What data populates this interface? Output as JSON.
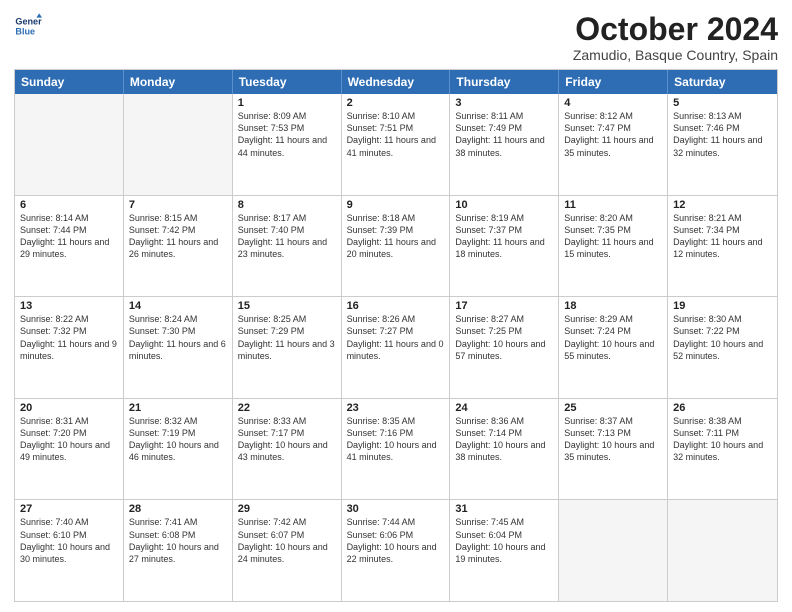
{
  "logo": {
    "line1": "General",
    "line2": "Blue"
  },
  "title": "October 2024",
  "location": "Zamudio, Basque Country, Spain",
  "days_of_week": [
    "Sunday",
    "Monday",
    "Tuesday",
    "Wednesday",
    "Thursday",
    "Friday",
    "Saturday"
  ],
  "weeks": [
    [
      {
        "day": "",
        "content": "",
        "empty": true
      },
      {
        "day": "",
        "content": "",
        "empty": true
      },
      {
        "day": "1",
        "content": "Sunrise: 8:09 AM\nSunset: 7:53 PM\nDaylight: 11 hours and 44 minutes."
      },
      {
        "day": "2",
        "content": "Sunrise: 8:10 AM\nSunset: 7:51 PM\nDaylight: 11 hours and 41 minutes."
      },
      {
        "day": "3",
        "content": "Sunrise: 8:11 AM\nSunset: 7:49 PM\nDaylight: 11 hours and 38 minutes."
      },
      {
        "day": "4",
        "content": "Sunrise: 8:12 AM\nSunset: 7:47 PM\nDaylight: 11 hours and 35 minutes."
      },
      {
        "day": "5",
        "content": "Sunrise: 8:13 AM\nSunset: 7:46 PM\nDaylight: 11 hours and 32 minutes."
      }
    ],
    [
      {
        "day": "6",
        "content": "Sunrise: 8:14 AM\nSunset: 7:44 PM\nDaylight: 11 hours and 29 minutes."
      },
      {
        "day": "7",
        "content": "Sunrise: 8:15 AM\nSunset: 7:42 PM\nDaylight: 11 hours and 26 minutes."
      },
      {
        "day": "8",
        "content": "Sunrise: 8:17 AM\nSunset: 7:40 PM\nDaylight: 11 hours and 23 minutes."
      },
      {
        "day": "9",
        "content": "Sunrise: 8:18 AM\nSunset: 7:39 PM\nDaylight: 11 hours and 20 minutes."
      },
      {
        "day": "10",
        "content": "Sunrise: 8:19 AM\nSunset: 7:37 PM\nDaylight: 11 hours and 18 minutes."
      },
      {
        "day": "11",
        "content": "Sunrise: 8:20 AM\nSunset: 7:35 PM\nDaylight: 11 hours and 15 minutes."
      },
      {
        "day": "12",
        "content": "Sunrise: 8:21 AM\nSunset: 7:34 PM\nDaylight: 11 hours and 12 minutes."
      }
    ],
    [
      {
        "day": "13",
        "content": "Sunrise: 8:22 AM\nSunset: 7:32 PM\nDaylight: 11 hours and 9 minutes."
      },
      {
        "day": "14",
        "content": "Sunrise: 8:24 AM\nSunset: 7:30 PM\nDaylight: 11 hours and 6 minutes."
      },
      {
        "day": "15",
        "content": "Sunrise: 8:25 AM\nSunset: 7:29 PM\nDaylight: 11 hours and 3 minutes."
      },
      {
        "day": "16",
        "content": "Sunrise: 8:26 AM\nSunset: 7:27 PM\nDaylight: 11 hours and 0 minutes."
      },
      {
        "day": "17",
        "content": "Sunrise: 8:27 AM\nSunset: 7:25 PM\nDaylight: 10 hours and 57 minutes."
      },
      {
        "day": "18",
        "content": "Sunrise: 8:29 AM\nSunset: 7:24 PM\nDaylight: 10 hours and 55 minutes."
      },
      {
        "day": "19",
        "content": "Sunrise: 8:30 AM\nSunset: 7:22 PM\nDaylight: 10 hours and 52 minutes."
      }
    ],
    [
      {
        "day": "20",
        "content": "Sunrise: 8:31 AM\nSunset: 7:20 PM\nDaylight: 10 hours and 49 minutes."
      },
      {
        "day": "21",
        "content": "Sunrise: 8:32 AM\nSunset: 7:19 PM\nDaylight: 10 hours and 46 minutes."
      },
      {
        "day": "22",
        "content": "Sunrise: 8:33 AM\nSunset: 7:17 PM\nDaylight: 10 hours and 43 minutes."
      },
      {
        "day": "23",
        "content": "Sunrise: 8:35 AM\nSunset: 7:16 PM\nDaylight: 10 hours and 41 minutes."
      },
      {
        "day": "24",
        "content": "Sunrise: 8:36 AM\nSunset: 7:14 PM\nDaylight: 10 hours and 38 minutes."
      },
      {
        "day": "25",
        "content": "Sunrise: 8:37 AM\nSunset: 7:13 PM\nDaylight: 10 hours and 35 minutes."
      },
      {
        "day": "26",
        "content": "Sunrise: 8:38 AM\nSunset: 7:11 PM\nDaylight: 10 hours and 32 minutes."
      }
    ],
    [
      {
        "day": "27",
        "content": "Sunrise: 7:40 AM\nSunset: 6:10 PM\nDaylight: 10 hours and 30 minutes."
      },
      {
        "day": "28",
        "content": "Sunrise: 7:41 AM\nSunset: 6:08 PM\nDaylight: 10 hours and 27 minutes."
      },
      {
        "day": "29",
        "content": "Sunrise: 7:42 AM\nSunset: 6:07 PM\nDaylight: 10 hours and 24 minutes."
      },
      {
        "day": "30",
        "content": "Sunrise: 7:44 AM\nSunset: 6:06 PM\nDaylight: 10 hours and 22 minutes."
      },
      {
        "day": "31",
        "content": "Sunrise: 7:45 AM\nSunset: 6:04 PM\nDaylight: 10 hours and 19 minutes."
      },
      {
        "day": "",
        "content": "",
        "empty": true
      },
      {
        "day": "",
        "content": "",
        "empty": true
      }
    ]
  ]
}
